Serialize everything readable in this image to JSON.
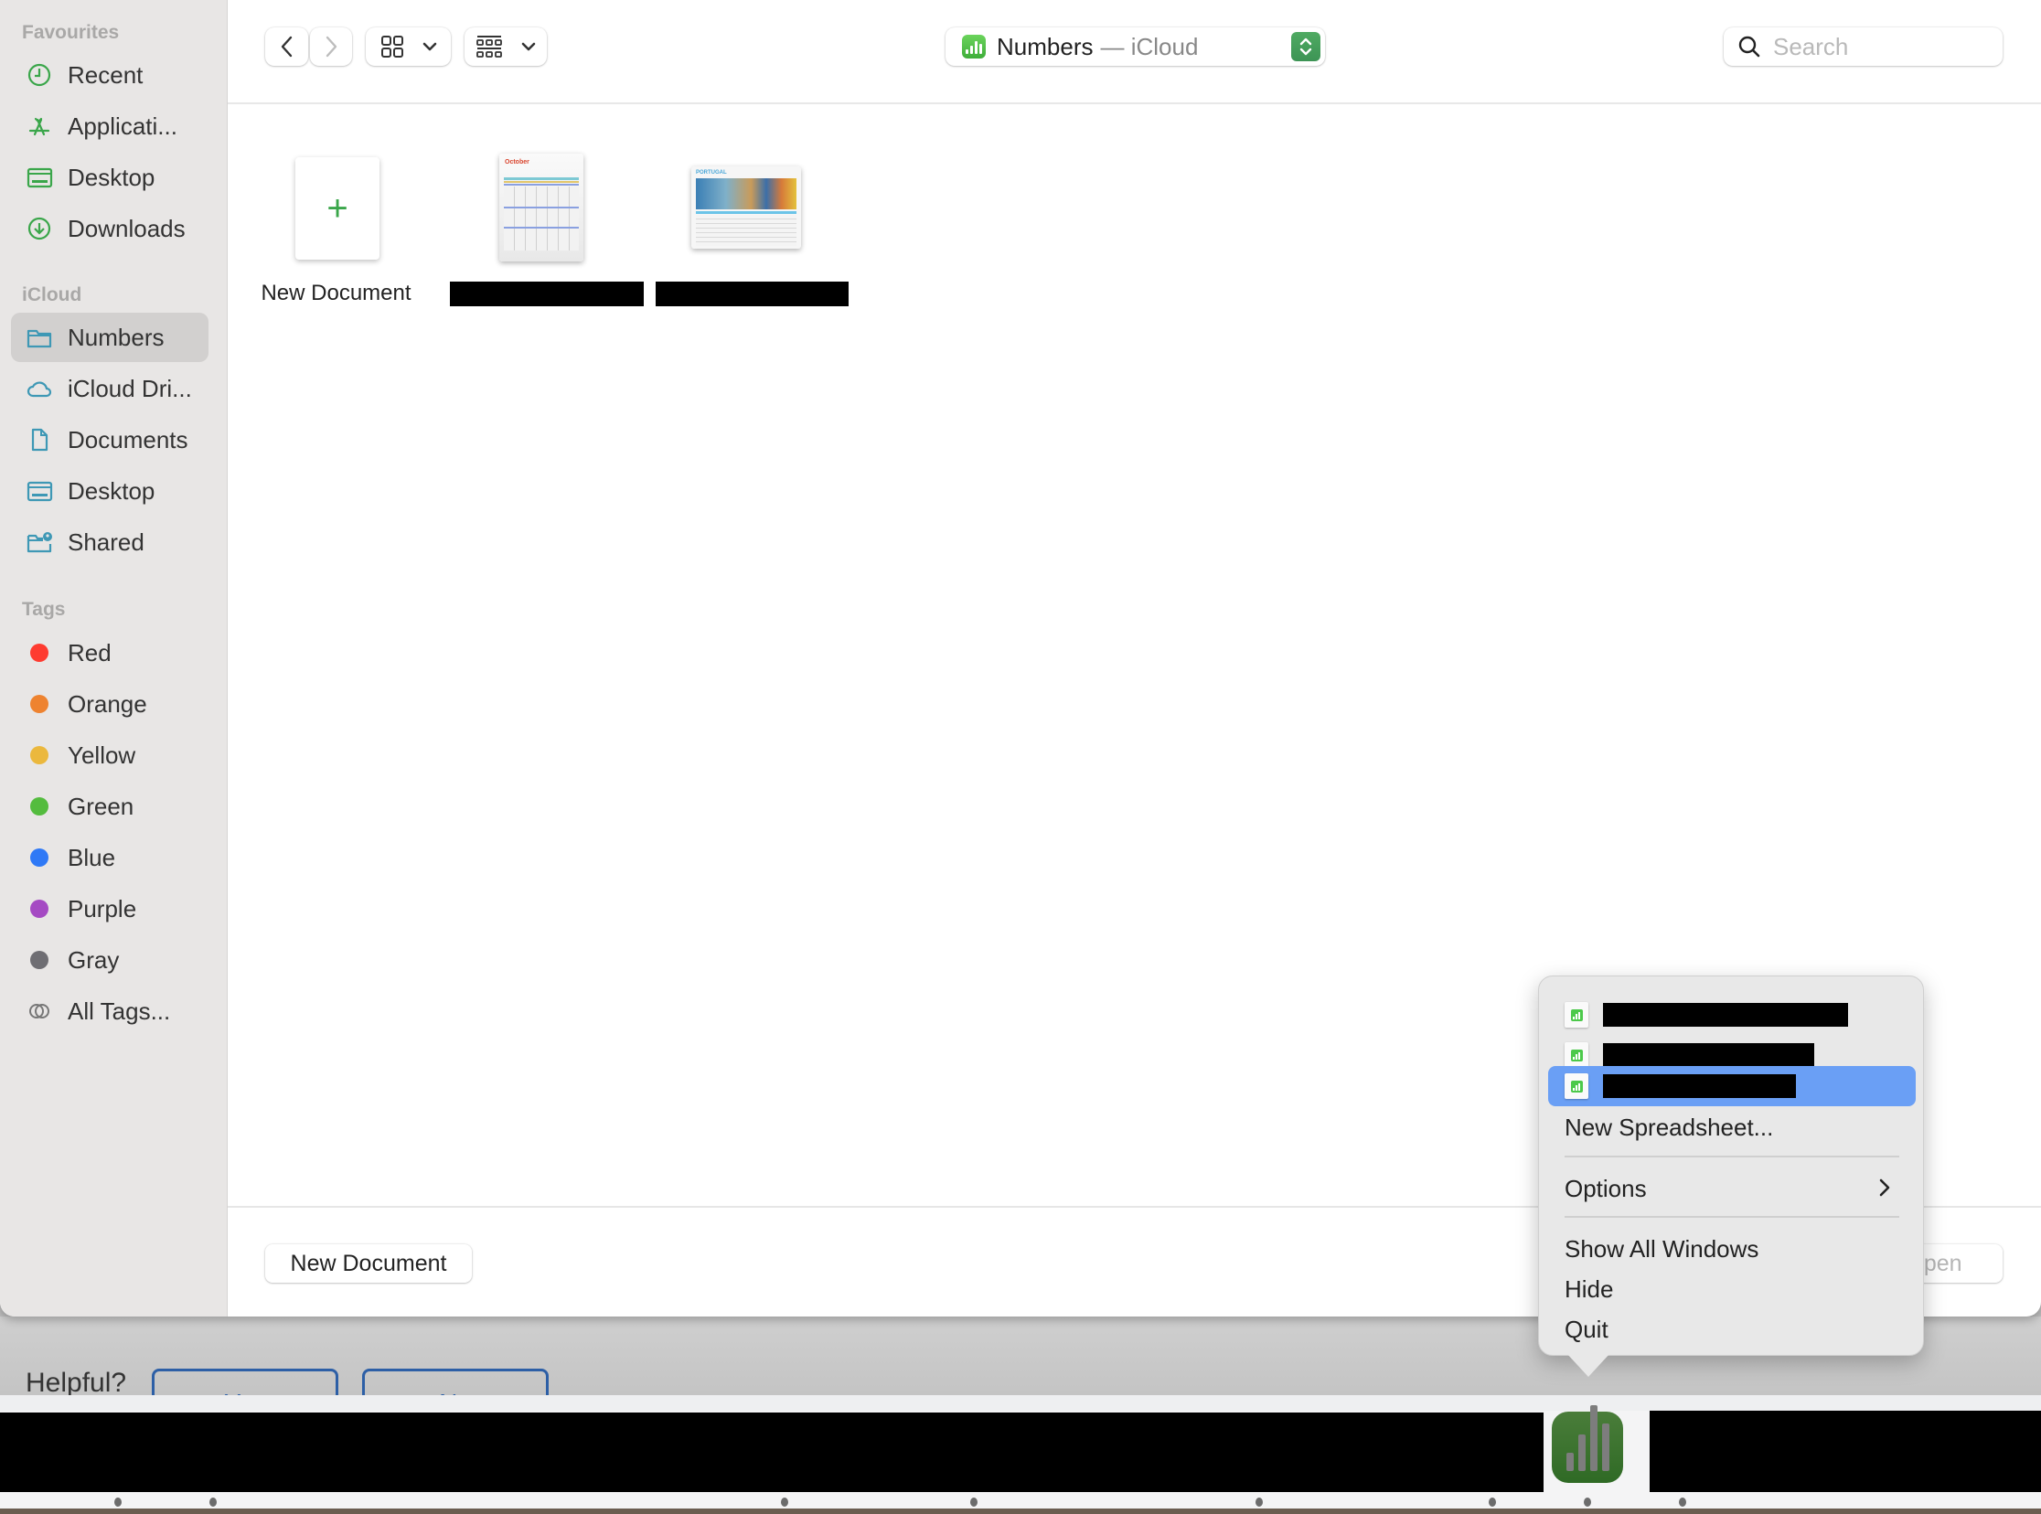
{
  "sidebar": {
    "sections": {
      "favourites": "Favourites",
      "icloud": "iCloud",
      "tags": "Tags"
    },
    "favourites": [
      {
        "label": "Recent",
        "icon": "clock-icon"
      },
      {
        "label": "Applicati...",
        "icon": "applications-icon"
      },
      {
        "label": "Desktop",
        "icon": "desktop-icon"
      },
      {
        "label": "Downloads",
        "icon": "download-icon"
      }
    ],
    "icloud": [
      {
        "label": "Numbers",
        "icon": "folder-icon",
        "selected": true
      },
      {
        "label": "iCloud Dri...",
        "icon": "cloud-icon"
      },
      {
        "label": "Documents",
        "icon": "document-icon"
      },
      {
        "label": "Desktop",
        "icon": "desktop-icon"
      },
      {
        "label": "Shared",
        "icon": "shared-folder-icon"
      }
    ],
    "tags": [
      {
        "label": "Red",
        "color": "#fe3b30"
      },
      {
        "label": "Orange",
        "color": "#ee8330"
      },
      {
        "label": "Yellow",
        "color": "#ebb83d"
      },
      {
        "label": "Green",
        "color": "#54bc3e"
      },
      {
        "label": "Blue",
        "color": "#2f79f6"
      },
      {
        "label": "Purple",
        "color": "#a54ac3"
      },
      {
        "label": "Gray",
        "color": "#6f6e73"
      },
      {
        "label": "All Tags...",
        "icon": "all-tags-icon"
      }
    ]
  },
  "toolbar": {
    "location_title": "Numbers",
    "location_suffix": "— iCloud",
    "search_placeholder": "Search"
  },
  "content": {
    "new_document_label": "New Document",
    "thumbnails": [
      {
        "title_text": "October",
        "kind": "calendar"
      },
      {
        "title_text": "PORTUGAL",
        "kind": "itinerary"
      }
    ]
  },
  "footer": {
    "new_document_button": "New Document",
    "open_button": "Open"
  },
  "help_bar": {
    "prompt": "Helpful?",
    "yes": "Yes",
    "no": "No"
  },
  "dock_menu": {
    "new_spreadsheet": "New Spreadsheet...",
    "options": "Options",
    "show_all_windows": "Show All Windows",
    "hide": "Hide",
    "quit": "Quit"
  },
  "colors": {
    "accent_green": "#3aa64a",
    "menu_highlight": "#6a9ff5",
    "sidebar_icon_green": "#3aa64a",
    "sidebar_icon_teal": "#3e98b5"
  }
}
